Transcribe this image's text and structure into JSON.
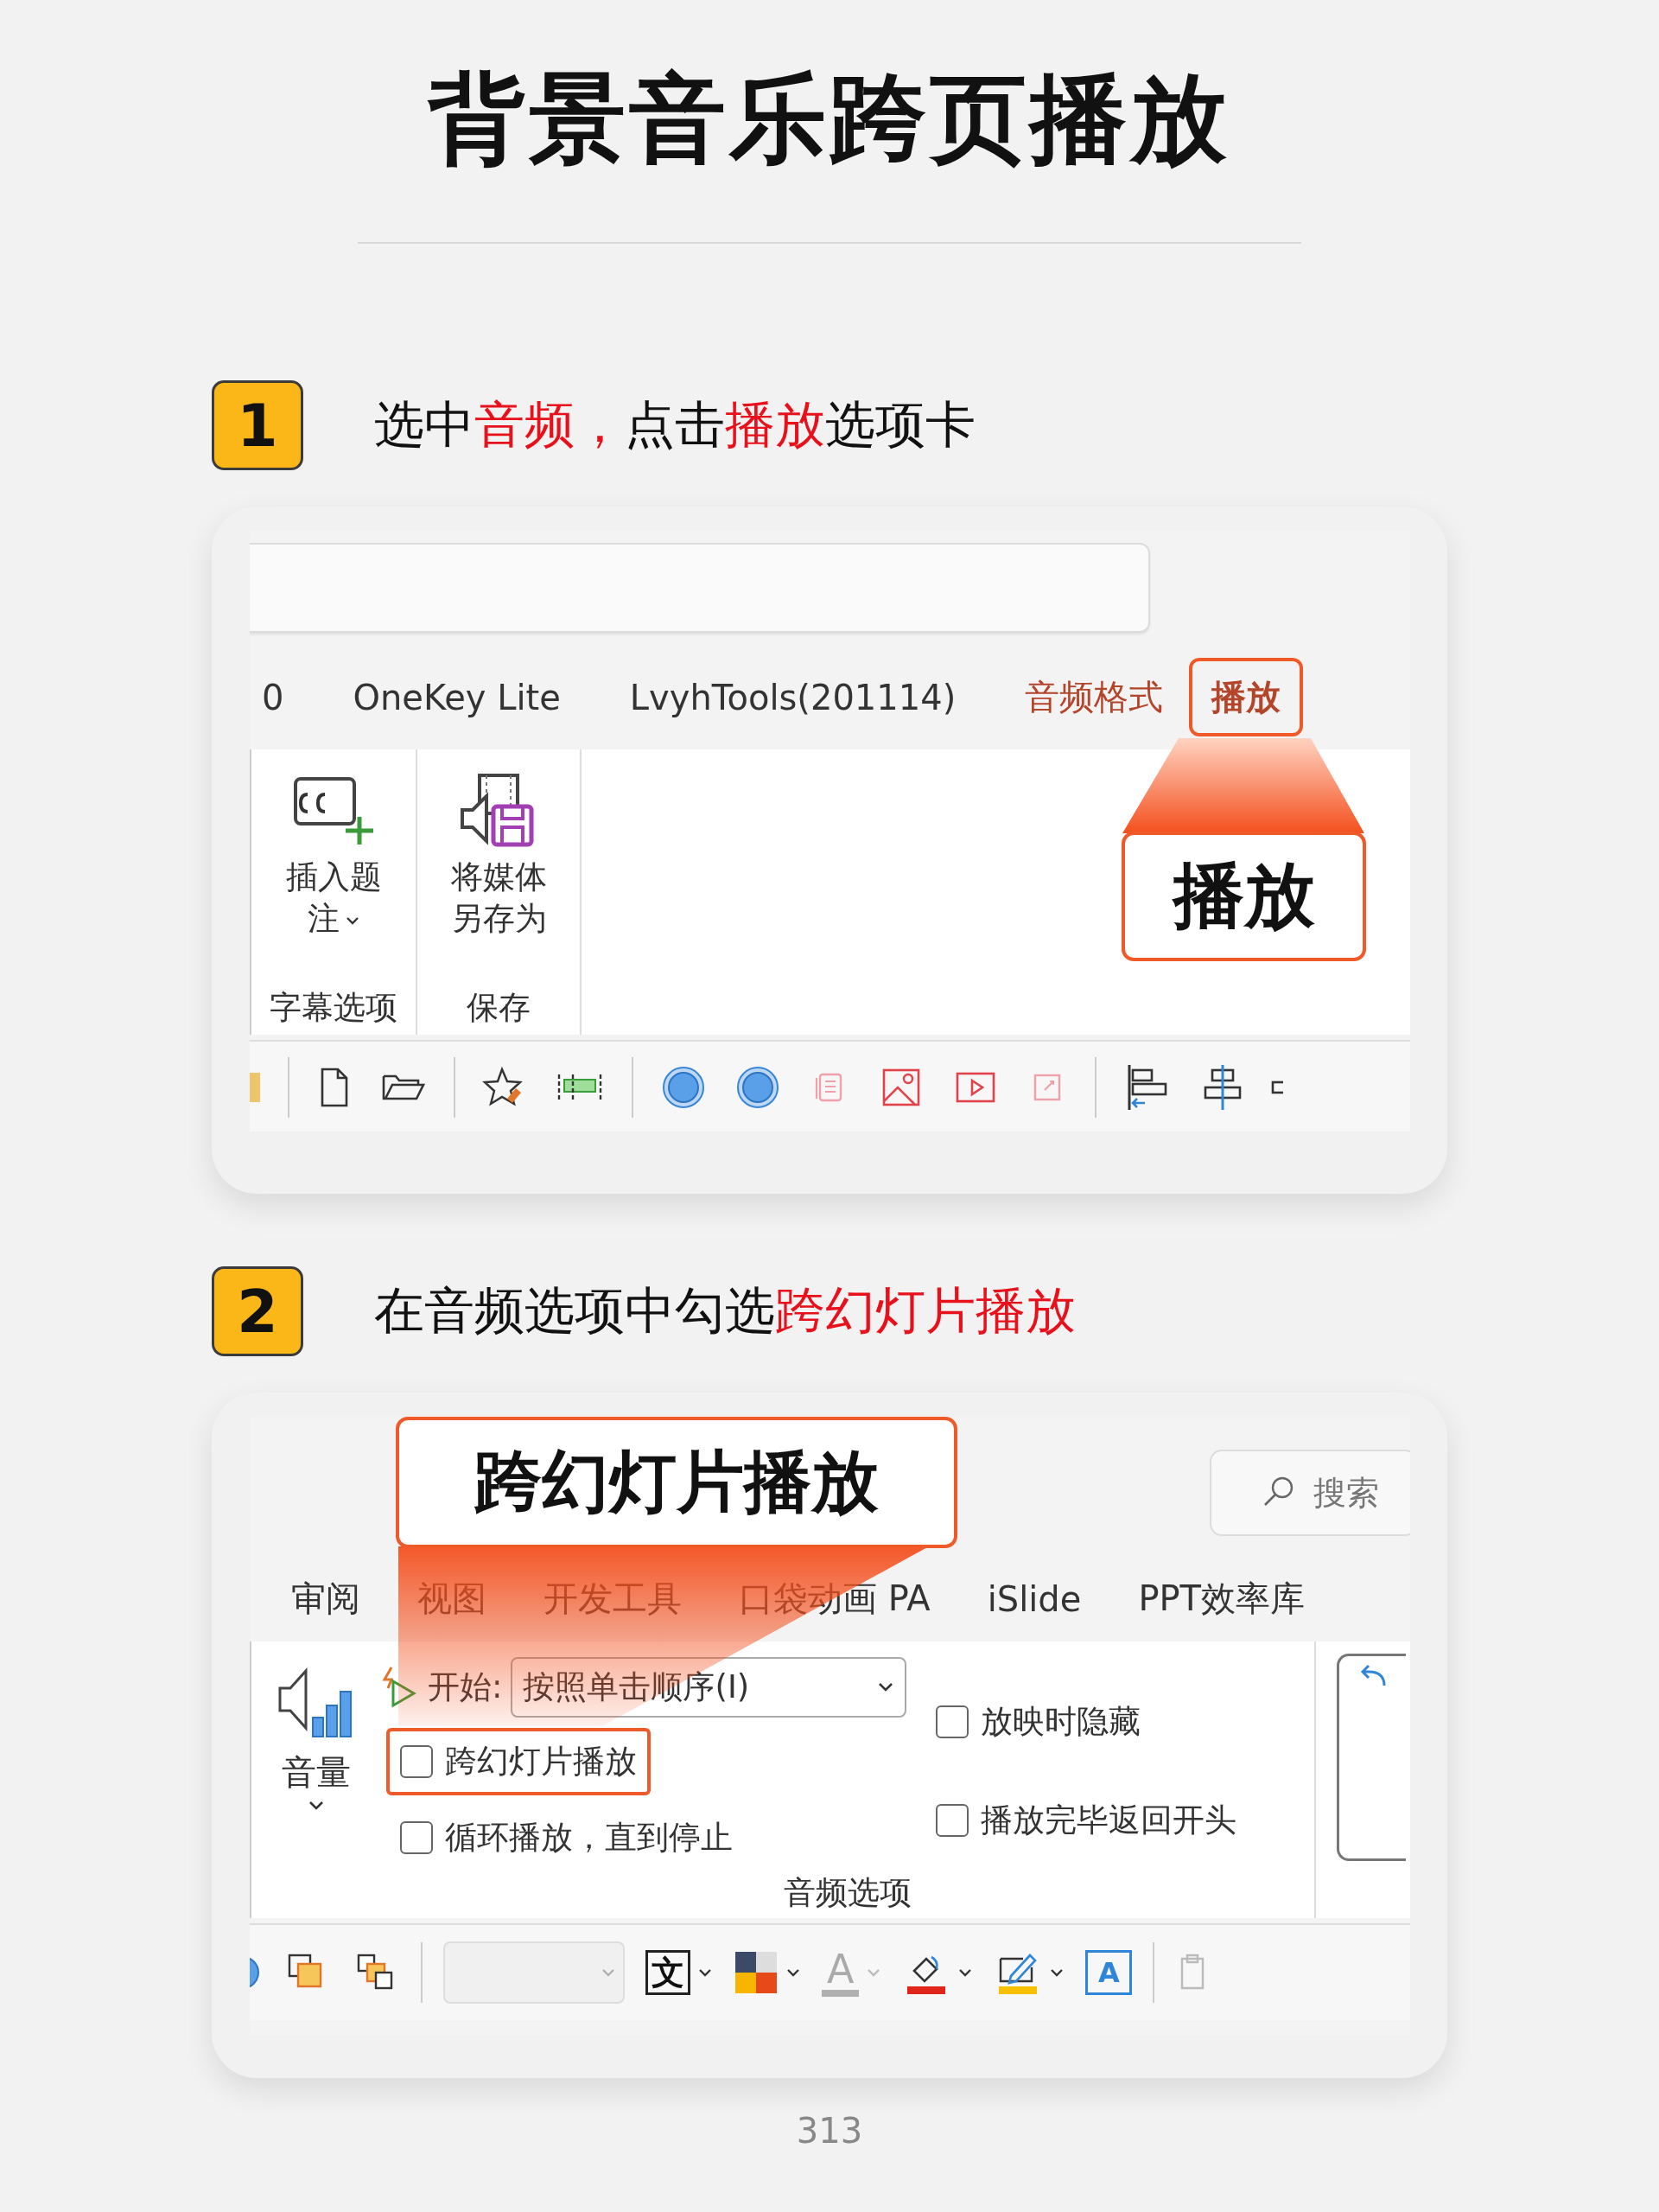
{
  "title": "背景音乐跨页播放",
  "step1": {
    "number": "1",
    "instruction": [
      {
        "text": "选中",
        "highlight": false
      },
      {
        "text": "音频，",
        "highlight": true
      },
      {
        "text": "点击",
        "highlight": false
      },
      {
        "text": "播放",
        "highlight": true
      },
      {
        "text": "选项卡",
        "highlight": false
      }
    ],
    "screenshot": {
      "tabs": [
        {
          "label": "0",
          "kind": "plain",
          "selected": false
        },
        {
          "label": "OneKey Lite",
          "kind": "plain",
          "selected": false
        },
        {
          "label": "LvyhTools(201114)",
          "kind": "plain",
          "selected": false
        },
        {
          "label": "音频格式",
          "kind": "context",
          "selected": false
        },
        {
          "label": "播放",
          "kind": "context",
          "selected": true
        }
      ],
      "groups": [
        {
          "label": "字幕选项",
          "button": "插入题注",
          "kind": "captions",
          "caret": true
        },
        {
          "label": "保存",
          "button": "将媒体另存为",
          "kind": "save",
          "caret": false
        }
      ],
      "callout": "播放"
    }
  },
  "step2": {
    "number": "2",
    "instruction": [
      {
        "text": "在音频选项中勾选",
        "highlight": false
      },
      {
        "text": "跨幻灯片播放",
        "highlight": true
      }
    ],
    "screenshot": {
      "search": {
        "placeholder": "搜索"
      },
      "tabs": [
        {
          "label": "审阅",
          "selected": false
        },
        {
          "label": "视图",
          "selected": false
        },
        {
          "label": "开发工具",
          "selected": false
        },
        {
          "label": "口袋动画 PA",
          "selected": false
        },
        {
          "label": "iSlide",
          "selected": false
        },
        {
          "label": "PPT效率库",
          "selected": false
        }
      ],
      "volume": {
        "label": "音量"
      },
      "start": {
        "label": "开始:",
        "value": "按照单击顺序(I)"
      },
      "options_left": [
        {
          "label": "跨幻灯片播放",
          "checked": false,
          "highlighted": true
        },
        {
          "label": "循环播放，直到停止",
          "checked": false,
          "highlighted": false
        }
      ],
      "options_right": [
        {
          "label": "放映时隐藏",
          "checked": false,
          "highlighted": false
        },
        {
          "label": "播放完毕返回开头",
          "checked": false,
          "highlighted": false
        }
      ],
      "group_label": "音频选项",
      "toolbar": {
        "text_direction_glyph": "文",
        "font_color_glyph": "A",
        "font_color_disabled": true,
        "text_box_glyph": "A"
      },
      "callout": "跨幻灯片播放"
    }
  },
  "page_number": "313"
}
